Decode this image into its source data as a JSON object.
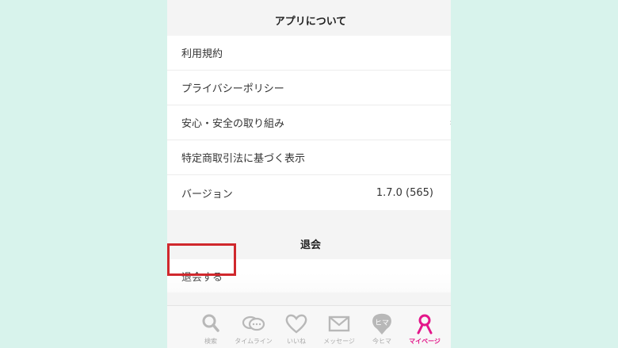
{
  "about_section": {
    "title": "アプリについて",
    "items": [
      {
        "label": "利用規約",
        "value": ""
      },
      {
        "label": "プライバシーポリシー",
        "value": ""
      },
      {
        "label": "安心・安全の取り組み",
        "value": ""
      },
      {
        "label": "特定商取引法に基づく表示",
        "value": ""
      },
      {
        "label": "バージョン",
        "value": "1.7.0 (565)"
      }
    ]
  },
  "withdraw_section": {
    "title": "退会",
    "button_label": "退会する"
  },
  "tabbar": {
    "tabs": [
      {
        "label": "検索",
        "icon": "search-icon"
      },
      {
        "label": "タイムライン",
        "icon": "chat-bubbles-icon"
      },
      {
        "label": "いいね",
        "icon": "heart-icon"
      },
      {
        "label": "メッセージ",
        "icon": "envelope-icon"
      },
      {
        "label": "今ヒマ",
        "icon": "pin-icon",
        "glyph": "ヒマ"
      },
      {
        "label": "マイページ",
        "icon": "person-icon"
      }
    ],
    "active_index": 5
  },
  "colors": {
    "accent": "#e3178a",
    "highlight_border": "#d0282d",
    "background": "#d8f3ec"
  }
}
